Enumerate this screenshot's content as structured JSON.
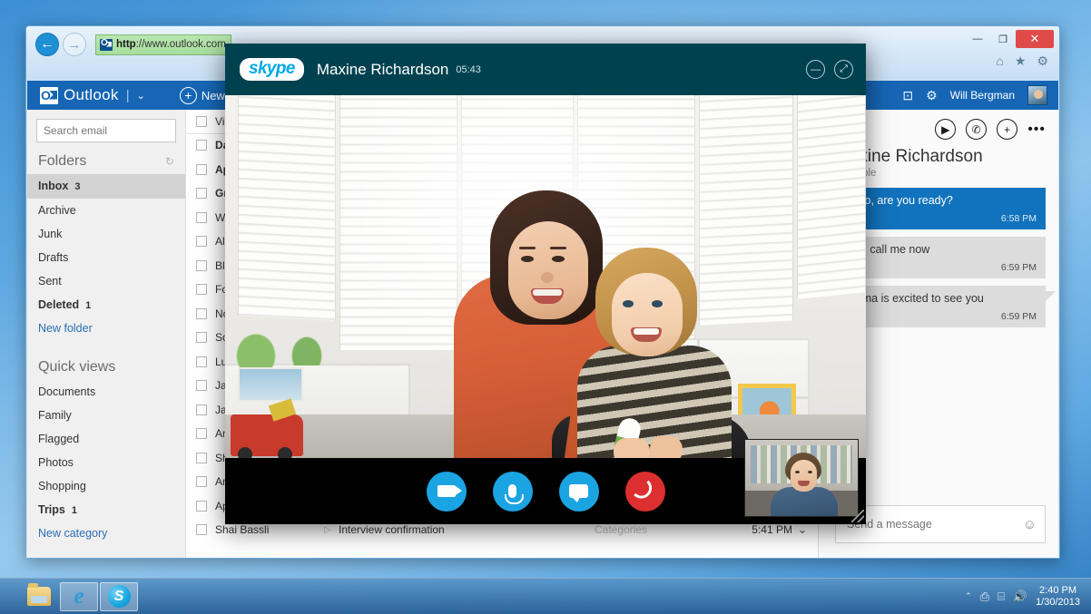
{
  "browser": {
    "url_scheme": "http",
    "url_rest": "://www.outlook.com",
    "back_icon": "←",
    "forward_icon": "→",
    "minimize_label": "—",
    "maximize_label": "❐",
    "close_label": "✕",
    "home_icon": "⌂",
    "favorites_icon": "★",
    "tools_icon": "⚙"
  },
  "outlook": {
    "brand": "Outlook",
    "brand_caret": "⌄",
    "new_label": "New",
    "new_plus": "+",
    "header_icons": {
      "messaging": "⊡",
      "settings": "⚙"
    },
    "user_name": "Will Bergman",
    "search": {
      "placeholder": "Search email",
      "value": "",
      "icon": "search-icon"
    },
    "folders_title": "Folders",
    "refresh_icon": "↻",
    "folders": [
      {
        "label": "Inbox",
        "count": "3",
        "active": true,
        "bold": true
      },
      {
        "label": "Archive",
        "count": "",
        "active": false,
        "bold": false
      },
      {
        "label": "Junk",
        "count": "",
        "active": false,
        "bold": false
      },
      {
        "label": "Drafts",
        "count": "",
        "active": false,
        "bold": false
      },
      {
        "label": "Sent",
        "count": "",
        "active": false,
        "bold": false
      },
      {
        "label": "Deleted",
        "count": "1",
        "active": false,
        "bold": true
      }
    ],
    "new_folder_label": "New folder",
    "quick_views_title": "Quick views",
    "quick_views": [
      {
        "label": "Documents",
        "count": "",
        "bold": false
      },
      {
        "label": "Family",
        "count": "",
        "bold": false
      },
      {
        "label": "Flagged",
        "count": "",
        "bold": false
      },
      {
        "label": "Photos",
        "count": "",
        "bold": false
      },
      {
        "label": "Shopping",
        "count": "",
        "bold": false
      },
      {
        "label": "Trips",
        "count": "1",
        "bold": true
      }
    ],
    "new_category_label": "New category",
    "list_scroll_icon": "⌄",
    "messages": [
      {
        "from": "View:",
        "subject": "",
        "categories": "",
        "time": "",
        "unread": false,
        "header": true
      },
      {
        "from": "David Neuman",
        "subject": "",
        "categories": "",
        "time": "",
        "unread": true,
        "header": false
      },
      {
        "from": "Apex Design",
        "subject": "",
        "categories": "",
        "time": "",
        "unread": true,
        "header": false
      },
      {
        "from": "Grace Lowell",
        "subject": "",
        "categories": "",
        "time": "",
        "unread": true,
        "header": false
      },
      {
        "from": "Will Bergman",
        "subject": "",
        "categories": "",
        "time": "",
        "unread": false,
        "header": false
      },
      {
        "from": "Alpine Travel",
        "subject": "",
        "categories": "",
        "time": "",
        "unread": false,
        "header": false
      },
      {
        "from": "Blue Ridge Co.",
        "subject": "",
        "categories": "",
        "time": "",
        "unread": false,
        "header": false
      },
      {
        "from": "Fourth Coffee",
        "subject": "",
        "categories": "",
        "time": "",
        "unread": false,
        "header": false
      },
      {
        "from": "Northwind",
        "subject": "",
        "categories": "",
        "time": "",
        "unread": false,
        "header": false
      },
      {
        "from": "Southridge",
        "subject": "",
        "categories": "",
        "time": "",
        "unread": false,
        "header": false
      },
      {
        "from": "Lucerne Pub.",
        "subject": "",
        "categories": "",
        "time": "",
        "unread": false,
        "header": false
      },
      {
        "from": "Jane Clayton",
        "subject": "",
        "categories": "",
        "time": "",
        "unread": false,
        "header": false
      },
      {
        "from": "Jay Hamlin",
        "subject": "",
        "categories": "",
        "time": "",
        "unread": false,
        "header": false
      },
      {
        "from": "Amanda Brady",
        "subject": "",
        "categories": "",
        "time": "",
        "unread": false,
        "header": false
      },
      {
        "from": "Sharon Salavaria",
        "subject": "",
        "categories": "",
        "time": "",
        "unread": false,
        "header": false
      },
      {
        "from": "Amy Alberts",
        "subject": "",
        "categories": "",
        "time": "",
        "unread": false,
        "header": false
      },
      {
        "from": "Apex Design",
        "subject": "",
        "categories": "",
        "time": "",
        "unread": false,
        "header": false
      },
      {
        "from": "Shai Bassli",
        "subject": "Interview confirmation",
        "categories": "Categories",
        "time": "5:41 PM",
        "unread": false,
        "header": false
      }
    ]
  },
  "chat": {
    "actions": {
      "video_call": "video-call-icon",
      "voice_call": "voice-call-icon",
      "add_people": "+",
      "more": "•••"
    },
    "contact_name": "Maxine Richardson",
    "status": "available",
    "messages": [
      {
        "text": "Hello, are you ready?",
        "time": "6:58 PM",
        "direction": "out"
      },
      {
        "text": "Yes, call me now",
        "time": "6:59 PM",
        "direction": "in"
      },
      {
        "text": "Emma is excited to see you",
        "time": "6:59 PM",
        "direction": "in"
      }
    ],
    "composer": {
      "placeholder": "Send a message",
      "value": "",
      "emoji_icon": "☺"
    }
  },
  "skype": {
    "logo_text": "skype",
    "contact_name": "Maxine Richardson",
    "call_timer": "05:43",
    "window_minimize": "—",
    "window_expand": "⤢",
    "controls": [
      {
        "name": "video-toggle-button",
        "icon": "camera",
        "color": "#1ba4e2"
      },
      {
        "name": "mute-button",
        "icon": "microphone",
        "color": "#1ba4e2"
      },
      {
        "name": "chat-button",
        "icon": "chat-bubble",
        "color": "#1ba4e2"
      },
      {
        "name": "hangup-button",
        "icon": "hangup",
        "color": "#dd2f2f"
      }
    ]
  },
  "taskbar": {
    "items": [
      {
        "name": "file-explorer",
        "icon": "folder-icon",
        "pressed": false
      },
      {
        "name": "internet-explorer",
        "icon": "ie-icon",
        "pressed": true
      },
      {
        "name": "skype",
        "icon": "skype-icon",
        "pressed": true
      }
    ],
    "tray": {
      "overflow_arrow": "⌃",
      "network_icon": "⎙",
      "action_icon": "⌸",
      "volume_icon": "🔊",
      "time": "2:40 PM",
      "date": "1/30/2013"
    }
  }
}
